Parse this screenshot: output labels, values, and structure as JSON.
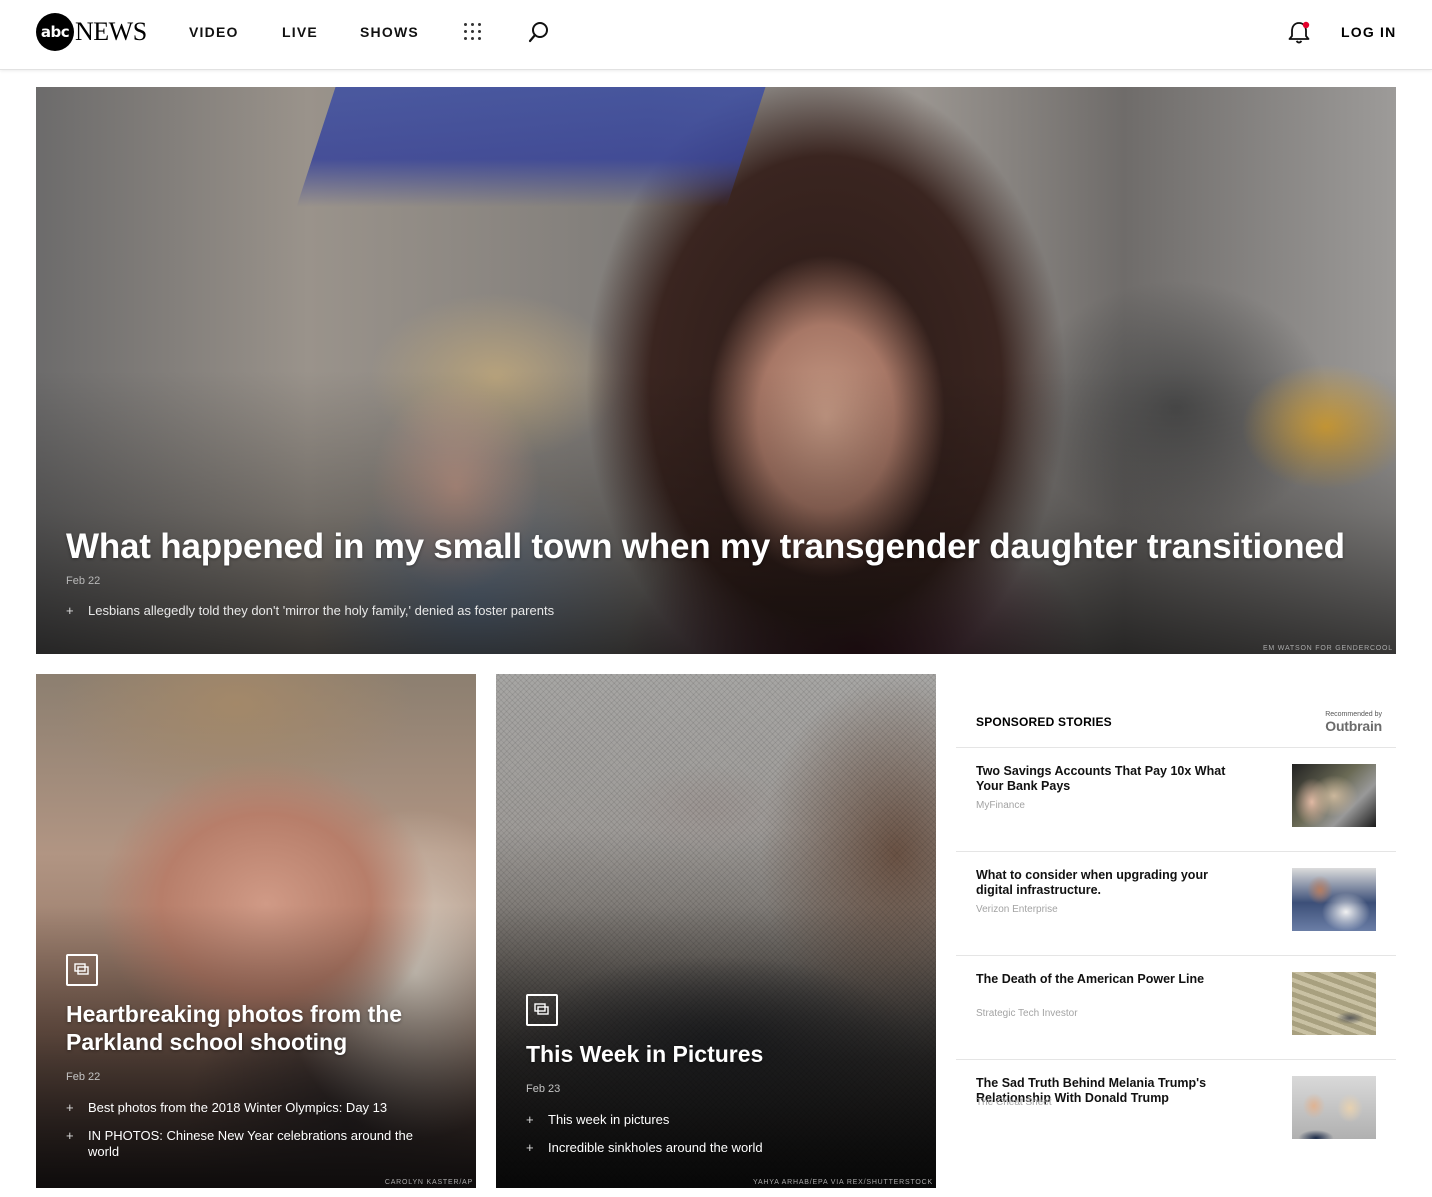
{
  "header": {
    "logo_mark": "abc",
    "logo_word": "NEWS",
    "nav": [
      "VIDEO",
      "LIVE",
      "SHOWS"
    ],
    "login": "LOG IN",
    "notification_dot_color": "#e4002b"
  },
  "hero": {
    "title": "What happened in my small town when my transgender daughter transitioned",
    "date": "Feb 22",
    "related": "Lesbians allegedly told they don't 'mirror the holy family,' denied as foster parents",
    "credit": "EM WATSON FOR GENDERCOOL"
  },
  "cards": [
    {
      "title_line1": "Heartbreaking photos from the",
      "title_line2": "Parkland school shooting",
      "date": "Feb 22",
      "related": [
        "Best photos from the 2018 Winter Olympics: Day 13",
        "IN PHOTOS: Chinese New Year celebrations around the world"
      ],
      "credit": "CAROLYN KASTER/AP"
    },
    {
      "title_line1": "This Week in Pictures",
      "date": "Feb 23",
      "related": [
        "This week in pictures",
        "Incredible sinkholes around the world"
      ],
      "credit": "YAHYA ARHAB/EPA VIA REX/SHUTTERSTOCK"
    }
  ],
  "sponsored": {
    "heading": "SPONSORED STORIES",
    "recommended_by": "Recommended by",
    "brand": "Outbrain",
    "items": [
      {
        "headline": "Two Savings Accounts That Pay 10x What Your Bank Pays",
        "source": "MyFinance"
      },
      {
        "headline": "What to consider when upgrading your digital infrastructure.",
        "source": "Verizon Enterprise"
      },
      {
        "headline": "The Death of the American Power Line",
        "source": "Strategic Tech Investor"
      },
      {
        "headline": "The Sad Truth Behind Melania Trump's Relationship With Donald Trump",
        "source": "The Cheat Sheet"
      }
    ]
  }
}
